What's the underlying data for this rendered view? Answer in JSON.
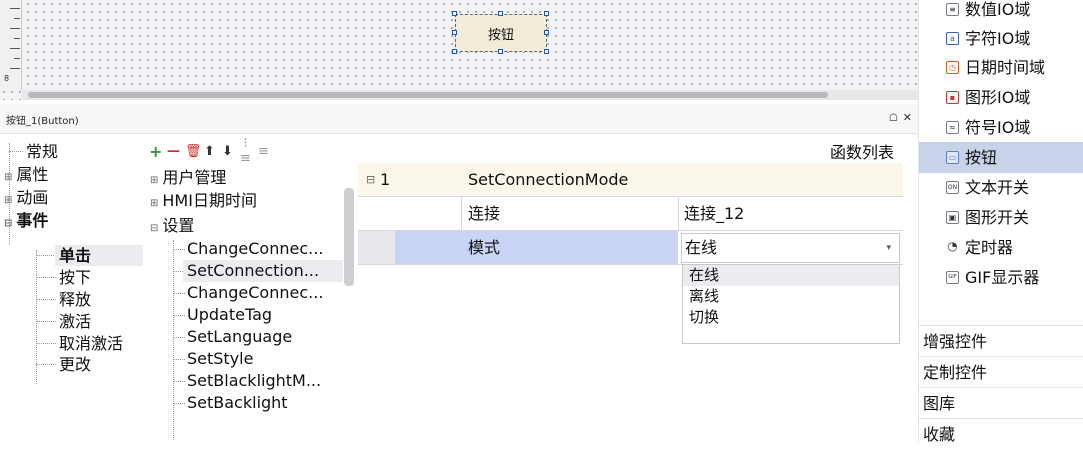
{
  "canvas": {
    "widget_label": "按钮",
    "ruler_number": "8"
  },
  "panel": {
    "title": "按钮_1(Button)",
    "pin_glyph": "ᗝ",
    "close_glyph": "✕"
  },
  "categories": [
    {
      "label": "常规"
    },
    {
      "label": "属性",
      "expander": "⊞"
    },
    {
      "label": "动画",
      "expander": "⊞"
    },
    {
      "label": "事件",
      "expander": "⊟"
    },
    {
      "label": "单击"
    },
    {
      "label": "按下"
    },
    {
      "label": "释放"
    },
    {
      "label": "激活"
    },
    {
      "label": "取消激活"
    },
    {
      "label": "更改"
    }
  ],
  "func_toolbar": {
    "add": "+",
    "remove": "—",
    "delete": "🗑",
    "up": "⬆",
    "down": "⬇",
    "indent": "⁝≡",
    "outdent": "≡"
  },
  "func_groups": [
    {
      "label": "用户管理",
      "expander": "⊞"
    },
    {
      "label": "HMI日期时间",
      "expander": "⊞"
    },
    {
      "label": "设置",
      "expander": "⊟"
    }
  ],
  "func_items": [
    "ChangeConnec...",
    "SetConnection...",
    "ChangeConnec...",
    "UpdateTag",
    "SetLanguage",
    "SetStyle",
    "SetBlacklightM...",
    "SetBacklight"
  ],
  "func_list_label": "函数列表",
  "grid": {
    "header": {
      "expander": "⊟",
      "index": "1",
      "function": "SetConnectionMode"
    },
    "rows": [
      {
        "param": "连接",
        "value": "连接_12"
      },
      {
        "param": "模式",
        "value": "在线",
        "arrow": "▾"
      }
    ]
  },
  "dropdown_options": [
    "在线",
    "离线",
    "切换"
  ],
  "toolbox": {
    "items": [
      {
        "icon": "≡",
        "label": "数值IO域"
      },
      {
        "icon": "a",
        "label": "字符IO域"
      },
      {
        "icon": "◷",
        "label": "日期时间域"
      },
      {
        "icon": "▪",
        "label": "图形IO域"
      },
      {
        "icon": "≈",
        "label": "符号IO域"
      },
      {
        "icon": "▭",
        "label": "按钮"
      },
      {
        "icon": "ON",
        "label": "文本开关"
      },
      {
        "icon": "▣",
        "label": "图形开关"
      },
      {
        "icon": "◔",
        "label": "定时器"
      },
      {
        "icon": "GIF",
        "label": "GIF显示器"
      }
    ],
    "sections": [
      "增强控件",
      "定制控件",
      "图库",
      "收藏"
    ]
  },
  "colors": {
    "selection": "#c8d3ea",
    "param_bg": "#c8d3f5",
    "header_bg": "#fbf7ea",
    "add_green": "#2e9e3a",
    "delete_red": "#d42b2b"
  }
}
